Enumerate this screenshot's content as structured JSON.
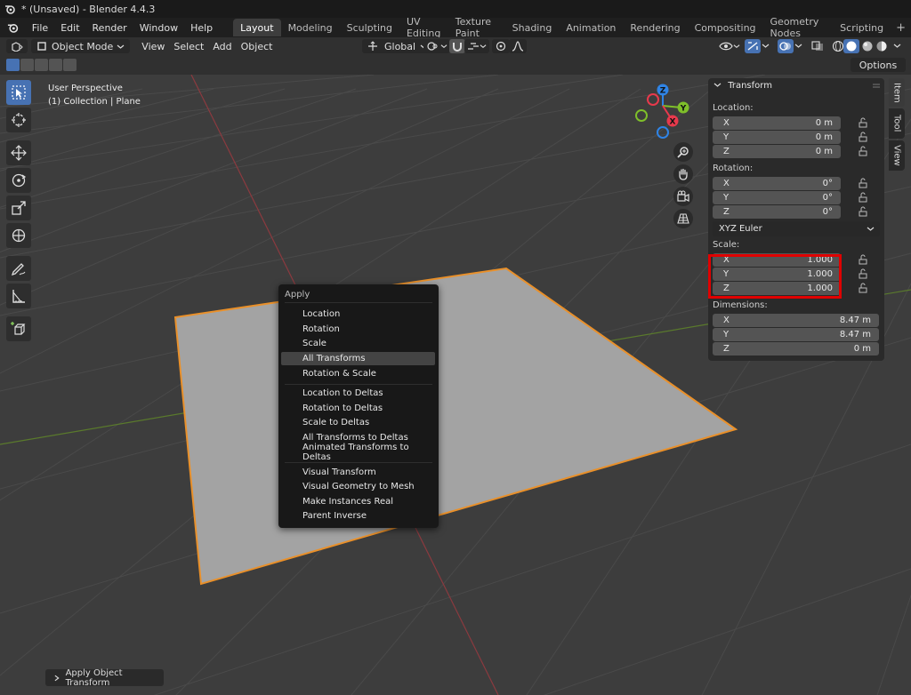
{
  "window": {
    "title": "* (Unsaved) - Blender 4.4.3"
  },
  "menu": [
    "File",
    "Edit",
    "Render",
    "Window",
    "Help"
  ],
  "workspaces": {
    "tabs": [
      "Layout",
      "Modeling",
      "Sculpting",
      "UV Editing",
      "Texture Paint",
      "Shading",
      "Animation",
      "Rendering",
      "Compositing",
      "Geometry Nodes",
      "Scripting"
    ],
    "active": "Layout",
    "add": "+"
  },
  "header": {
    "mode": "Object Mode",
    "menus": [
      "View",
      "Select",
      "Add",
      "Object"
    ],
    "orientation": "Global",
    "options": "Options"
  },
  "viewport": {
    "perspective": "User Perspective",
    "context": "(1) Collection | Plane",
    "gizmo": {
      "z": "Z",
      "y": "Y",
      "x": "X"
    }
  },
  "npanel": {
    "tabs": [
      "Item",
      "Tool",
      "View"
    ],
    "active_tab": "Item",
    "section": "Transform",
    "location": {
      "label": "Location:",
      "rows": [
        {
          "axis": "X",
          "value": "0 m"
        },
        {
          "axis": "Y",
          "value": "0 m"
        },
        {
          "axis": "Z",
          "value": "0 m"
        }
      ]
    },
    "rotation": {
      "label": "Rotation:",
      "rows": [
        {
          "axis": "X",
          "value": "0°"
        },
        {
          "axis": "Y",
          "value": "0°"
        },
        {
          "axis": "Z",
          "value": "0°"
        }
      ],
      "mode": "XYZ Euler"
    },
    "scale": {
      "label": "Scale:",
      "rows": [
        {
          "axis": "X",
          "value": "1.000"
        },
        {
          "axis": "Y",
          "value": "1.000"
        },
        {
          "axis": "Z",
          "value": "1.000"
        }
      ]
    },
    "dimensions": {
      "label": "Dimensions:",
      "rows": [
        {
          "axis": "X",
          "value": "8.47 m"
        },
        {
          "axis": "Y",
          "value": "8.47 m"
        },
        {
          "axis": "Z",
          "value": "0 m"
        }
      ]
    }
  },
  "apply_menu": {
    "title": "Apply",
    "group1": [
      "Location",
      "Rotation",
      "Scale",
      "All Transforms",
      "Rotation & Scale"
    ],
    "group2": [
      "Location to Deltas",
      "Rotation to Deltas",
      "Scale to Deltas",
      "All Transforms to Deltas",
      "Animated Transforms to Deltas"
    ],
    "group3": [
      "Visual Transform",
      "Visual Geometry to Mesh",
      "Make Instances Real",
      "Parent Inverse"
    ],
    "highlighted": "All Transforms"
  },
  "last_operator": "Apply Object Transform",
  "colors": {
    "accent": "#4772b3",
    "selection_outline": "#e9902a",
    "highlight_box": "#e00000",
    "axis_x": "#e8394c",
    "axis_y": "#7fbf2a",
    "axis_z": "#2f84e6"
  }
}
